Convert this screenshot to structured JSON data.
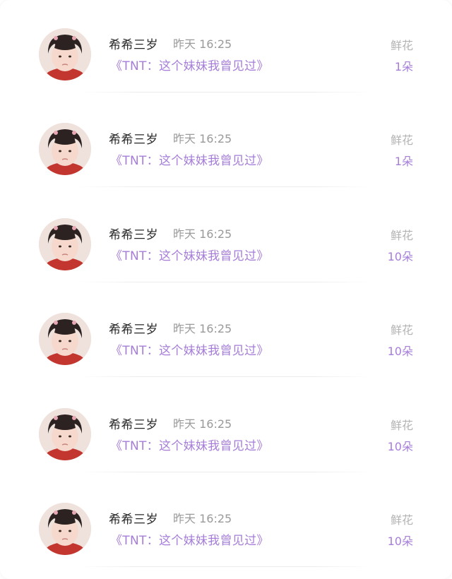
{
  "comments": [
    {
      "user": "希希三岁",
      "time": "昨天 16:25",
      "book": "《TNT：这个妹妹我曾见过》",
      "gift_label": "鲜花",
      "gift_count": "1朵"
    },
    {
      "user": "希希三岁",
      "time": "昨天 16:25",
      "book": "《TNT：这个妹妹我曾见过》",
      "gift_label": "鲜花",
      "gift_count": "1朵"
    },
    {
      "user": "希希三岁",
      "time": "昨天 16:25",
      "book": "《TNT：这个妹妹我曾见过》",
      "gift_label": "鲜花",
      "gift_count": "10朵"
    },
    {
      "user": "希希三岁",
      "time": "昨天 16:25",
      "book": "《TNT：这个妹妹我曾见过》",
      "gift_label": "鲜花",
      "gift_count": "10朵"
    },
    {
      "user": "希希三岁",
      "time": "昨天 16:25",
      "book": "《TNT：这个妹妹我曾见过》",
      "gift_label": "鲜花",
      "gift_count": "10朵"
    },
    {
      "user": "希希三岁",
      "time": "昨天 16:25",
      "book": "《TNT：这个妹妹我曾见过》",
      "gift_label": "鲜花",
      "gift_count": "10朵"
    }
  ],
  "colors": {
    "accent": "#a67ed8",
    "name_text": "#262626",
    "time_text": "#9a9a9a",
    "gift_label_text": "#b3b3b3",
    "background": "#ffffff"
  }
}
